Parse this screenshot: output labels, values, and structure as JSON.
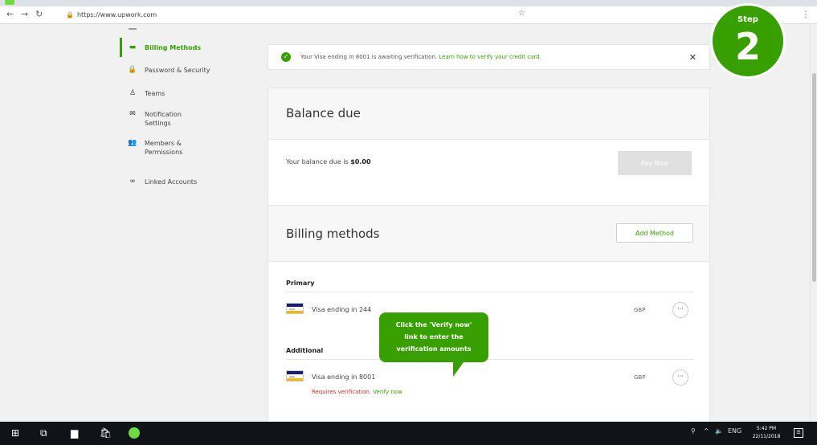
{
  "browser": {
    "url": "https://www.upwork.com"
  },
  "sidebar": {
    "items": [
      {
        "label": "Billing Methods",
        "icon": "card-icon",
        "active": true
      },
      {
        "label": "Password & Security",
        "icon": "lock-icon"
      },
      {
        "label": "Teams",
        "icon": "teams-icon"
      },
      {
        "label": "Notification Settings",
        "icon": "envelope-icon"
      },
      {
        "label": "Members & Permissions",
        "icon": "members-icon"
      },
      {
        "label": "Linked Accounts",
        "icon": "link-icon"
      }
    ]
  },
  "alert": {
    "text": "Your Visa ending in 8001 is awaiting verification.",
    "link": "Learn how to verify your credit card."
  },
  "balance": {
    "title": "Balance due",
    "prefix": "Your balance due is",
    "amount": "$0.00",
    "pay_button": "Pay Now"
  },
  "billing": {
    "title": "Billing methods",
    "add_button": "Add Method",
    "primary_label": "Primary",
    "primary_card": "Visa ending in 244",
    "primary_currency": "GBP",
    "additional_label": "Additional",
    "additional_card": "Visa ending in 8001",
    "additional_currency": "GBP",
    "requires": "Requires verification.",
    "verify_link": "Verify now"
  },
  "tooltip": {
    "line1": "Click the 'Verify now'",
    "line2": "link to enter the",
    "line3": "verification amounts"
  },
  "step": {
    "label": "Step",
    "number": "2"
  },
  "taskbar": {
    "lang": "ENG",
    "time": "5:42 PM",
    "date": "22/11/2018"
  },
  "colors": {
    "accent": "#37a000",
    "taskbar": "#101418",
    "error": "#d93025"
  }
}
